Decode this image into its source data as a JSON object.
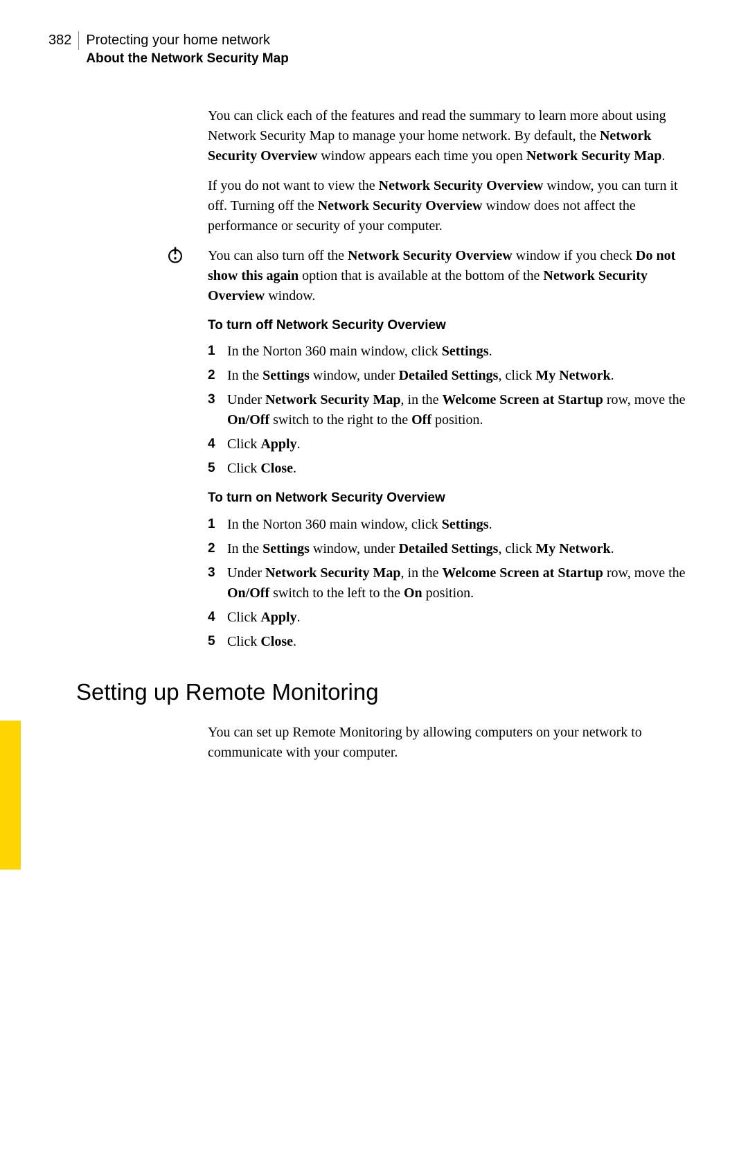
{
  "header": {
    "page_number": "382",
    "chapter": "Protecting your home network",
    "section": "About the Network Security Map"
  },
  "p1": {
    "t1": "You can click each of the features and read the summary to learn more about using Network Security Map to manage your home network. By default, the ",
    "b1": "Network Security Overview",
    "t2": " window appears each time you open ",
    "b2": "Network Security Map",
    "t3": "."
  },
  "p2": {
    "t1": "If you do not want to view the ",
    "b1": "Network Security Overview",
    "t2": " window, you can turn it off. Turning off the ",
    "b2": "Network Security Overview",
    "t3": " window does not affect the performance or security of your computer."
  },
  "p3": {
    "t1": "You can also turn off the ",
    "b1": "Network Security Overview",
    "t2": " window if you check ",
    "b2": "Do not show this again",
    "t3": " option that is available at the bottom of the ",
    "b3": "Network Security Overview",
    "t4": " window."
  },
  "procA": {
    "title": "To turn off Network Security Overview",
    "s1": {
      "t1": "In the Norton 360 main window, click ",
      "b1": "Settings",
      "t2": "."
    },
    "s2": {
      "t1": "In the ",
      "b1": "Settings",
      "t2": " window, under ",
      "b2": "Detailed Settings",
      "t3": ", click ",
      "b3": "My Network",
      "t4": "."
    },
    "s3": {
      "t1": "Under ",
      "b1": "Network Security Map",
      "t2": ", in the ",
      "b2": "Welcome Screen at Startup",
      "t3": " row, move the ",
      "b3": "On/Off",
      "t4": " switch to the right to the ",
      "b4": "Off",
      "t5": " position."
    },
    "s4": {
      "t1": "Click ",
      "b1": "Apply",
      "t2": "."
    },
    "s5": {
      "t1": "Click ",
      "b1": "Close",
      "t2": "."
    }
  },
  "procB": {
    "title": "To turn on Network Security Overview",
    "s1": {
      "t1": "In the Norton 360 main window, click ",
      "b1": "Settings",
      "t2": "."
    },
    "s2": {
      "t1": "In the ",
      "b1": "Settings",
      "t2": " window, under ",
      "b2": "Detailed Settings",
      "t3": ", click ",
      "b3": "My Network",
      "t4": "."
    },
    "s3": {
      "t1": "Under ",
      "b1": "Network Security Map",
      "t2": ", in the ",
      "b2": "Welcome Screen at Startup",
      "t3": " row, move the ",
      "b3": "On/Off",
      "t4": " switch to the left to the ",
      "b4": "On",
      "t5": " position."
    },
    "s4": {
      "t1": "Click ",
      "b1": "Apply",
      "t2": "."
    },
    "s5": {
      "t1": "Click ",
      "b1": "Close",
      "t2": "."
    }
  },
  "heading2": "Setting up Remote Monitoring",
  "p4": "You can set up Remote Monitoring by allowing computers on your network to communicate with your computer."
}
